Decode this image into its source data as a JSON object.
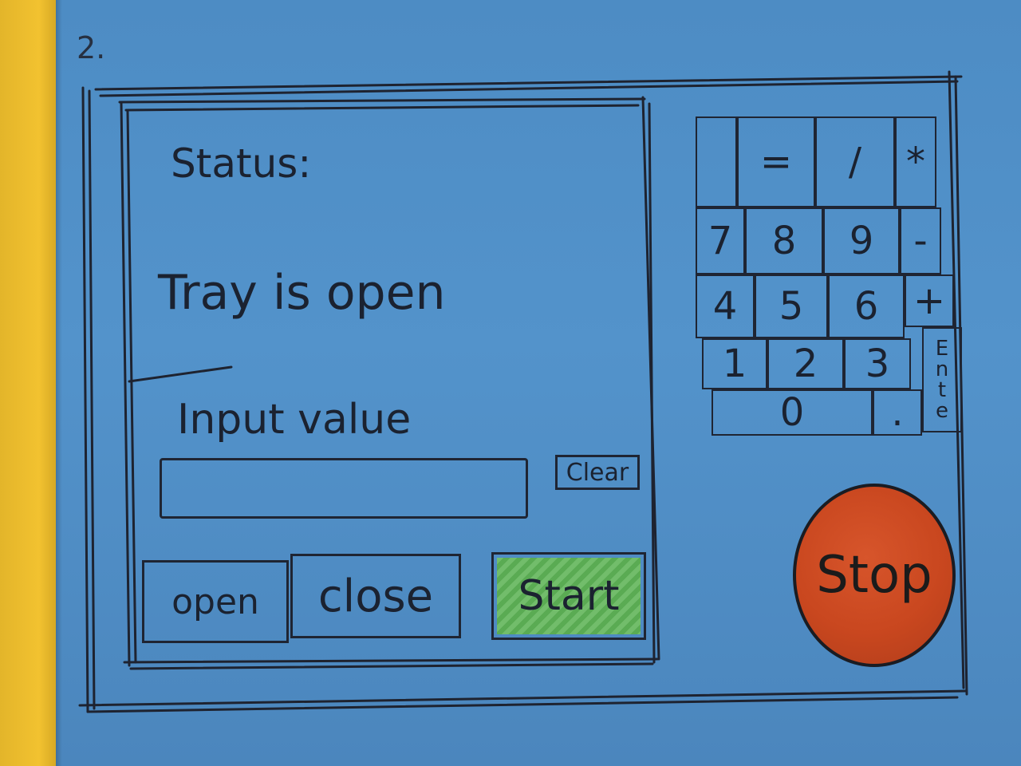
{
  "page_number": "2.",
  "status_panel": {
    "status_label": "Status:",
    "status_value": "Tray is open"
  },
  "input_section": {
    "label": "Input value",
    "value": "",
    "clear_label": "Clear"
  },
  "action_buttons": {
    "open_label": "open",
    "close_label": "close",
    "start_label": "Start"
  },
  "keypad": {
    "keys": {
      "equals": "=",
      "divide": "/",
      "multiply": "*",
      "seven": "7",
      "eight": "8",
      "nine": "9",
      "minus": "-",
      "four": "4",
      "five": "5",
      "six": "6",
      "plus": "+",
      "one": "1",
      "two": "2",
      "three": "3",
      "zero": "0",
      "decimal": ".",
      "enter_letters": [
        "E",
        "n",
        "t",
        "e"
      ]
    }
  },
  "stop_button": {
    "label": "Stop"
  },
  "colors": {
    "paper": "#5393cb",
    "ink": "#1b2230",
    "start_fill": "#5fb457",
    "stop_fill": "#c9471f",
    "yellow_edge": "#f2c230"
  }
}
